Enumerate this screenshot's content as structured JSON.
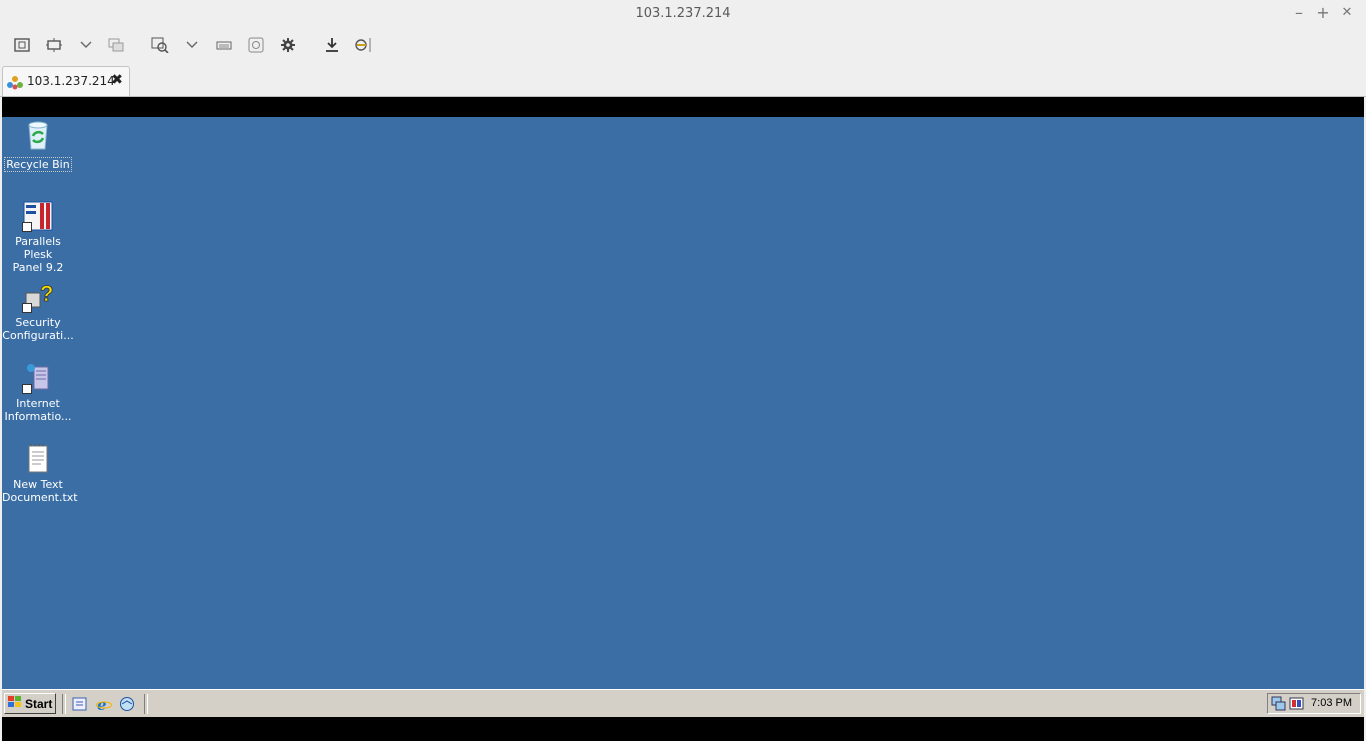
{
  "window": {
    "title": "103.1.237.214",
    "minimize": "–",
    "maximize": "+",
    "close": "✕"
  },
  "toolbar": {
    "icons": [
      "fit-window-icon",
      "fullscreen-icon",
      "chevron-down-icon",
      "multi-monitor-icon",
      "zoom-icon",
      "chevron-down-icon",
      "keyboard-icon",
      "screenshot-icon",
      "gear-icon",
      "download-icon",
      "disconnect-icon"
    ]
  },
  "tab": {
    "label": "103.1.237.214",
    "close": "✖"
  },
  "desktop": {
    "background": "#3a6ea5",
    "icons": [
      {
        "line1": "Recycle Bin",
        "line2": ""
      },
      {
        "line1": "Parallels Plesk",
        "line2": "Panel 9.2"
      },
      {
        "line1": "Security",
        "line2": "Configurati..."
      },
      {
        "line1": "Internet",
        "line2": "Informatio..."
      },
      {
        "line1": "New Text",
        "line2": "Document.txt"
      }
    ]
  },
  "taskbar": {
    "start_label": "Start",
    "quick_launch": [
      "server-manager-icon",
      "internet-explorer-icon",
      "outlook-express-icon"
    ],
    "clock": "7:03 PM"
  }
}
